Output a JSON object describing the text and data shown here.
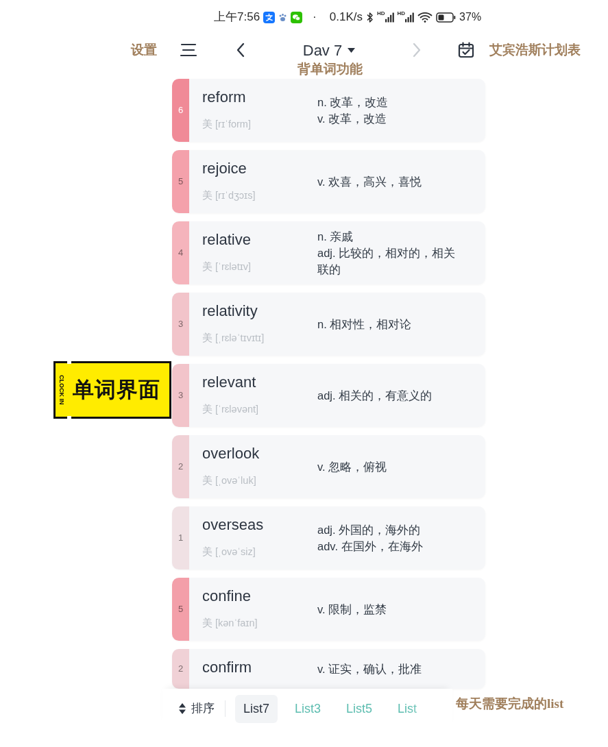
{
  "status_bar": {
    "time": "上午7:56",
    "separator": "·",
    "network_speed": "0.1K/s",
    "signals": [
      {
        "label": "HD"
      },
      {
        "label": "HD"
      }
    ],
    "battery": "37%"
  },
  "header": {
    "left_note": "设置",
    "title": "Dav 7",
    "next_disabled": true,
    "right_note": "艾宾浩斯计划表",
    "subtitle_note": "背单词功能"
  },
  "words": [
    {
      "count": "6",
      "color": "#f08a97",
      "word": "reform",
      "phonetic": "美 [rɪˈform]",
      "definitions": [
        "n. 改革，改造",
        "v. 改革，改造"
      ]
    },
    {
      "count": "5",
      "color": "#f4a1ab",
      "word": "rejoice",
      "phonetic": "美 [rɪˈdʒɔɪs]",
      "definitions": [
        "v. 欢喜，高兴，喜悦"
      ]
    },
    {
      "count": "4",
      "color": "#f5b4bc",
      "word": "relative",
      "phonetic": "美 [ˈrɛlətɪv]",
      "definitions": [
        "n. 亲戚",
        "adj. 比较的，相对的，相关联的"
      ]
    },
    {
      "count": "3",
      "color": "#f2c4ca",
      "word": "relativity",
      "phonetic": "美 [ˌrɛləˈtɪvɪtɪ]",
      "definitions": [
        "n. 相对性，相对论"
      ]
    },
    {
      "count": "3",
      "color": "#f2c4ca",
      "word": "relevant",
      "phonetic": "美 [ˈrɛləvənt]",
      "definitions": [
        "adj. 相关的，有意义的"
      ]
    },
    {
      "count": "2",
      "color": "#f0d1d6",
      "word": "overlook",
      "phonetic": "美 [ˌovəˈluk]",
      "definitions": [
        "v. 忽略，俯视"
      ]
    },
    {
      "count": "1",
      "color": "#f0e1e4",
      "word": "overseas",
      "phonetic": "美 [ˌovəˈsiz]",
      "definitions": [
        "adj. 外国的，海外的",
        "adv. 在国外，在海外"
      ]
    },
    {
      "count": "5",
      "color": "#f39fa9",
      "word": "confine",
      "phonetic": "美 [kənˈfaɪn]",
      "definitions": [
        "v. 限制，监禁"
      ]
    },
    {
      "count": "2",
      "color": "#f0d1d6",
      "word": "confirm",
      "definitions": [
        "v. 证实，确认，批准"
      ]
    }
  ],
  "sticker": {
    "tag": "CLOCK IN",
    "title": "单词界面"
  },
  "bottom_bar": {
    "sort_label": "排序",
    "tabs": [
      {
        "label": "List7",
        "selected": true
      },
      {
        "label": "List3",
        "selected": false
      },
      {
        "label": "List5",
        "selected": false
      },
      {
        "label": "List",
        "selected": false
      }
    ],
    "note": "每天需要完成的list"
  }
}
